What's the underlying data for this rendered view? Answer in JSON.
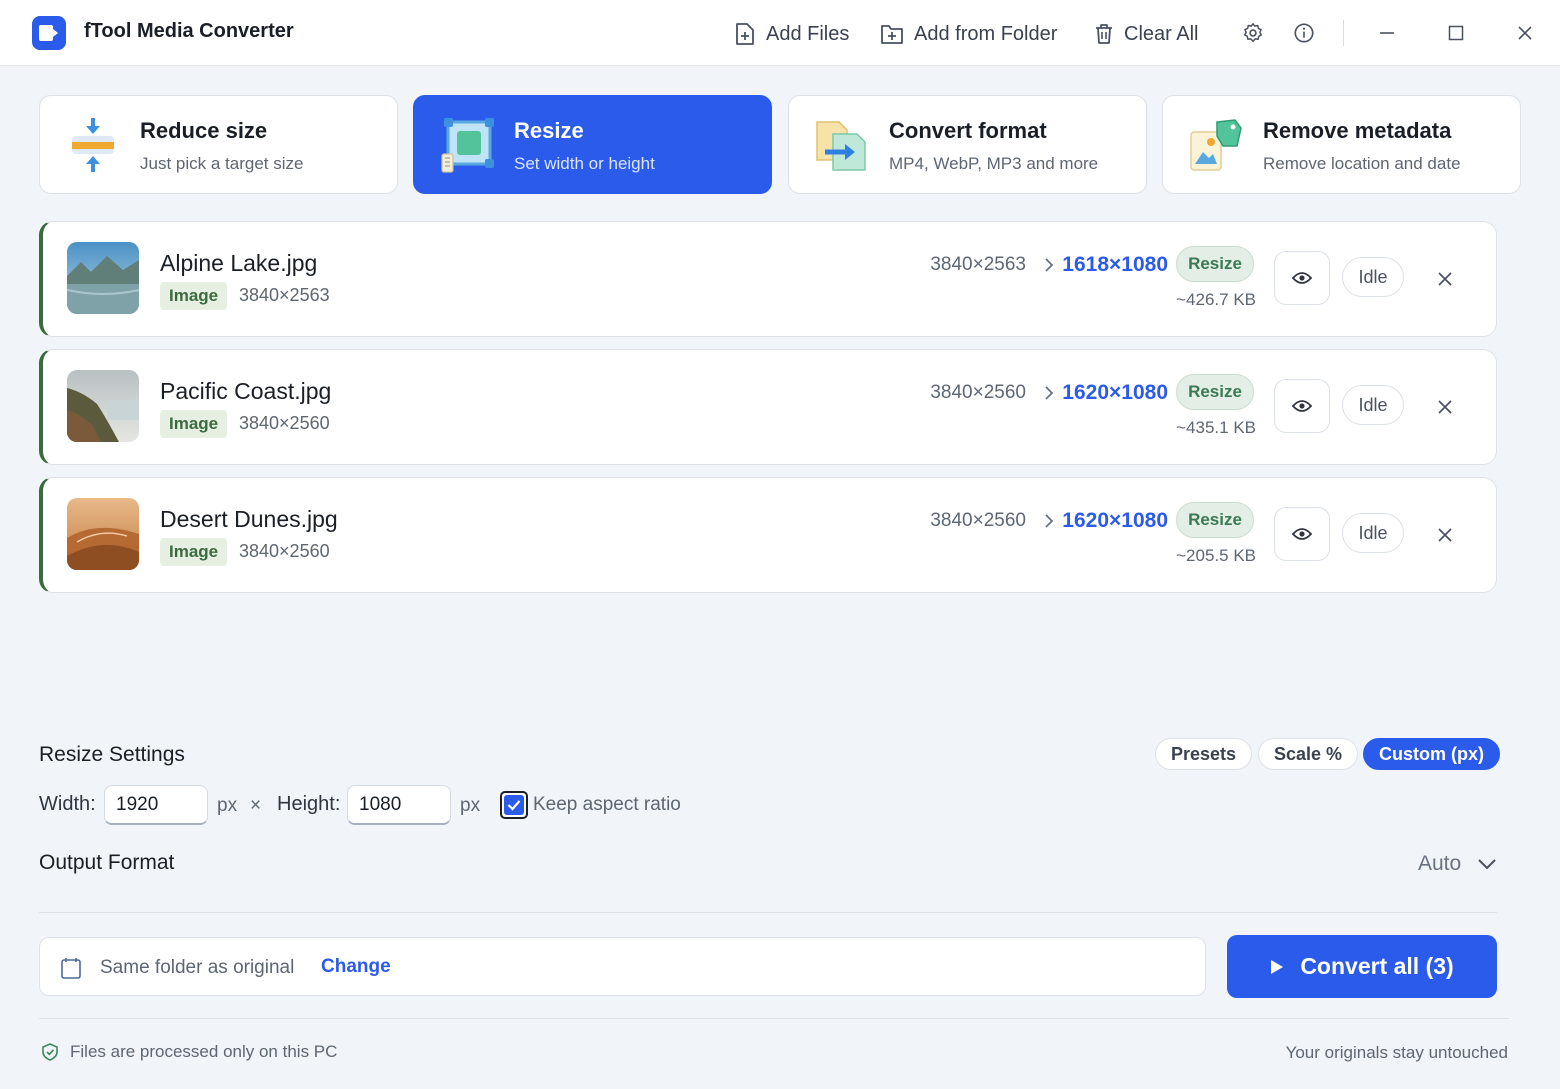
{
  "app": {
    "title": "fTool Media Converter"
  },
  "toolbar": {
    "add_files": "Add Files",
    "add_folder": "Add from Folder",
    "clear_all": "Clear All"
  },
  "modes": [
    {
      "title": "Reduce size",
      "subtitle": "Just pick a target size",
      "icon": "compress-icon"
    },
    {
      "title": "Resize",
      "subtitle": "Set width or height",
      "icon": "resize-icon",
      "active": true
    },
    {
      "title": "Convert format",
      "subtitle": "MP4, WebP, MP3 and more",
      "icon": "convert-icon"
    },
    {
      "title": "Remove metadata",
      "subtitle": "Remove location and date",
      "icon": "metadata-tag-icon"
    }
  ],
  "files": [
    {
      "name": "Alpine Lake.jpg",
      "type": "Image",
      "dims": "3840×2563",
      "from": "3840×2563",
      "to": "1618×1080",
      "op": "Resize",
      "size": "~426.7 KB",
      "status": "Idle"
    },
    {
      "name": "Pacific Coast.jpg",
      "type": "Image",
      "dims": "3840×2560",
      "from": "3840×2560",
      "to": "1620×1080",
      "op": "Resize",
      "size": "~435.1 KB",
      "status": "Idle"
    },
    {
      "name": "Desert Dunes.jpg",
      "type": "Image",
      "dims": "3840×2560",
      "from": "3840×2560",
      "to": "1620×1080",
      "op": "Resize",
      "size": "~205.5 KB",
      "status": "Idle"
    }
  ],
  "settings": {
    "title": "Resize Settings",
    "tabs": {
      "presets": "Presets",
      "scale": "Scale %",
      "custom": "Custom (px)"
    },
    "active_tab": "custom",
    "width_label": "Width:",
    "width_value": "1920",
    "height_label": "Height:",
    "height_value": "1080",
    "unit": "px",
    "times": "×",
    "keep_aspect": "Keep aspect ratio",
    "keep_aspect_checked": true
  },
  "output": {
    "title": "Output Format",
    "value": "Auto",
    "folder_text": "Same folder as original",
    "change": "Change",
    "convert": "Convert all (3)"
  },
  "footer": {
    "left": "Files are processed only on this PC",
    "right": "Your originals stay untouched"
  },
  "colors": {
    "accent": "#2b5bea",
    "badge_green": "#3b6b3f",
    "op_green": "#3b7a54"
  }
}
